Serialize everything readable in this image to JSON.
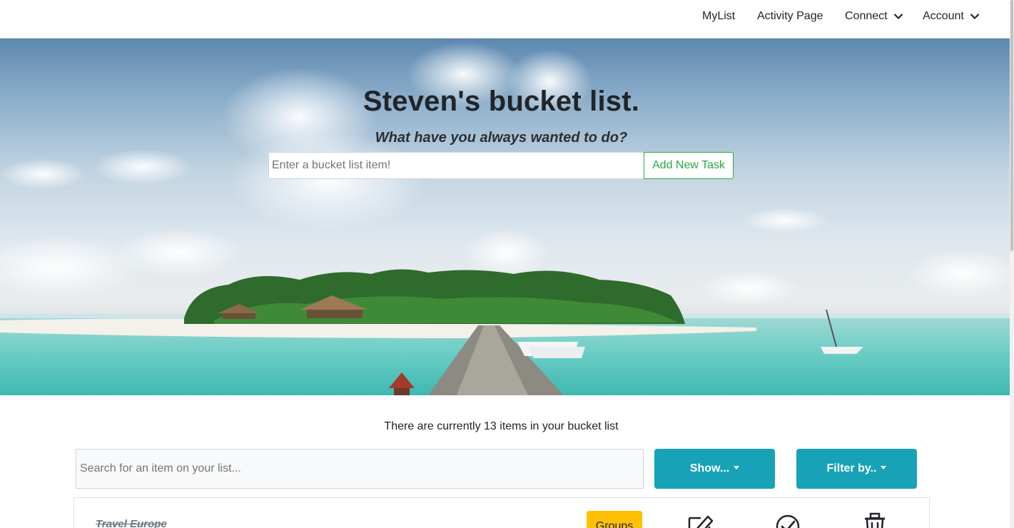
{
  "nav": {
    "items": [
      {
        "label": "MyList",
        "dropdown": false
      },
      {
        "label": "Activity Page",
        "dropdown": false
      },
      {
        "label": "Connect",
        "dropdown": true
      },
      {
        "label": "Account",
        "dropdown": true
      }
    ]
  },
  "hero": {
    "title": "Steven's bucket list.",
    "subtitle": "What have you always wanted to do?",
    "input_placeholder": "Enter a bucket list item!",
    "add_button_label": "Add New Task"
  },
  "list": {
    "count_text": "There are currently 13 items in your bucket list",
    "search_placeholder": "Search for an item on your list...",
    "show_button_label": "Show...",
    "filter_button_label": "Filter by..",
    "items": [
      {
        "title": "Travel Europe",
        "completed": true,
        "groups_label": "Groups"
      }
    ]
  },
  "colors": {
    "info": "#17a2b8",
    "success": "#28a745",
    "warning": "#ffc107"
  },
  "icons": [
    "chevron-down-icon",
    "edit-icon",
    "check-circle-icon",
    "trash-icon"
  ]
}
